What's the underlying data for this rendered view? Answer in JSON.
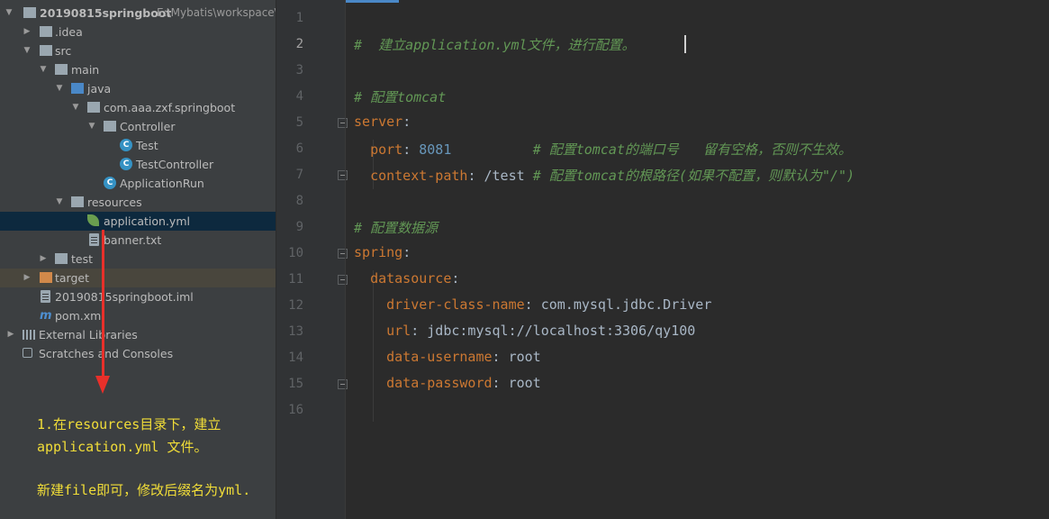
{
  "project_tree": [
    {
      "label": "20190815springboot",
      "path": "E:\\Mybatis\\workspace\\",
      "icon": "module-folder-icon",
      "expanded": true,
      "bold": true
    },
    {
      "label": ".idea",
      "icon": "folder-icon",
      "expanded": false
    },
    {
      "label": "src",
      "icon": "folder-icon",
      "expanded": true
    },
    {
      "label": "main",
      "icon": "folder-icon",
      "expanded": true
    },
    {
      "label": "java",
      "icon": "source-folder-icon",
      "expanded": true
    },
    {
      "label": "com.aaa.zxf.springboot",
      "icon": "package-icon",
      "expanded": true
    },
    {
      "label": "Controller",
      "icon": "package-icon",
      "expanded": true
    },
    {
      "label": "Test",
      "icon": "class-icon"
    },
    {
      "label": "TestController",
      "icon": "class-icon"
    },
    {
      "label": "ApplicationRun",
      "icon": "spring-boot-class-icon"
    },
    {
      "label": "resources",
      "icon": "resources-folder-icon",
      "expanded": true
    },
    {
      "label": "application.yml",
      "icon": "spring-yml-icon",
      "selected": true
    },
    {
      "label": "banner.txt",
      "icon": "text-file-icon"
    },
    {
      "label": "test",
      "icon": "folder-icon",
      "expanded": false
    },
    {
      "label": "target",
      "icon": "excluded-folder-icon",
      "expanded": false
    },
    {
      "label": "20190815springboot.iml",
      "icon": "iml-file-icon"
    },
    {
      "label": "pom.xml",
      "icon": "maven-icon",
      "prefix": "m"
    },
    {
      "label": "External Libraries",
      "icon": "libraries-icon",
      "expanded": false
    },
    {
      "label": "Scratches and Consoles",
      "icon": "scratches-icon"
    }
  ],
  "editor": {
    "line_numbers": [
      "1",
      "2",
      "3",
      "4",
      "5",
      "6",
      "7",
      "8",
      "9",
      "10",
      "11",
      "12",
      "13",
      "14",
      "15",
      "16"
    ],
    "lines": {
      "l2_comment": "#  建立application.yml文件，进行配置。",
      "l4_comment": "# 配置tomcat",
      "l5_key": "server",
      "l6_key": "port",
      "l6_val": "8081",
      "l6_comment": "# 配置tomcat的端口号   留有空格，否则不生效。",
      "l7_key": "context-path",
      "l7_val": "/test",
      "l7_comment": "# 配置tomcat的根路径(如果不配置，则默认为\"/\")",
      "l9_comment": "# 配置数据源",
      "l10_key": "spring",
      "l11_key": "datasource",
      "l12_key": "driver-class-name",
      "l12_val": "com.mysql.jdbc.Driver",
      "l13_key": "url",
      "l13_val": "jdbc:mysql://localhost:3306/qy100",
      "l14_key": "data-username",
      "l14_val": "root",
      "l15_key": "data-password",
      "l15_val": "root",
      "colon": ":"
    }
  },
  "annotation": {
    "line1": "1.在resources目录下，建立",
    "line2": "application.yml 文件。",
    "line3": "新建file即可，修改后缀名为yml."
  },
  "colors": {
    "keyword": "#cc7832",
    "comment": "#629755",
    "number": "#6897bb",
    "annotation": "#f1dd38",
    "arrow": "#e8302a",
    "selection": "#0d293e"
  }
}
